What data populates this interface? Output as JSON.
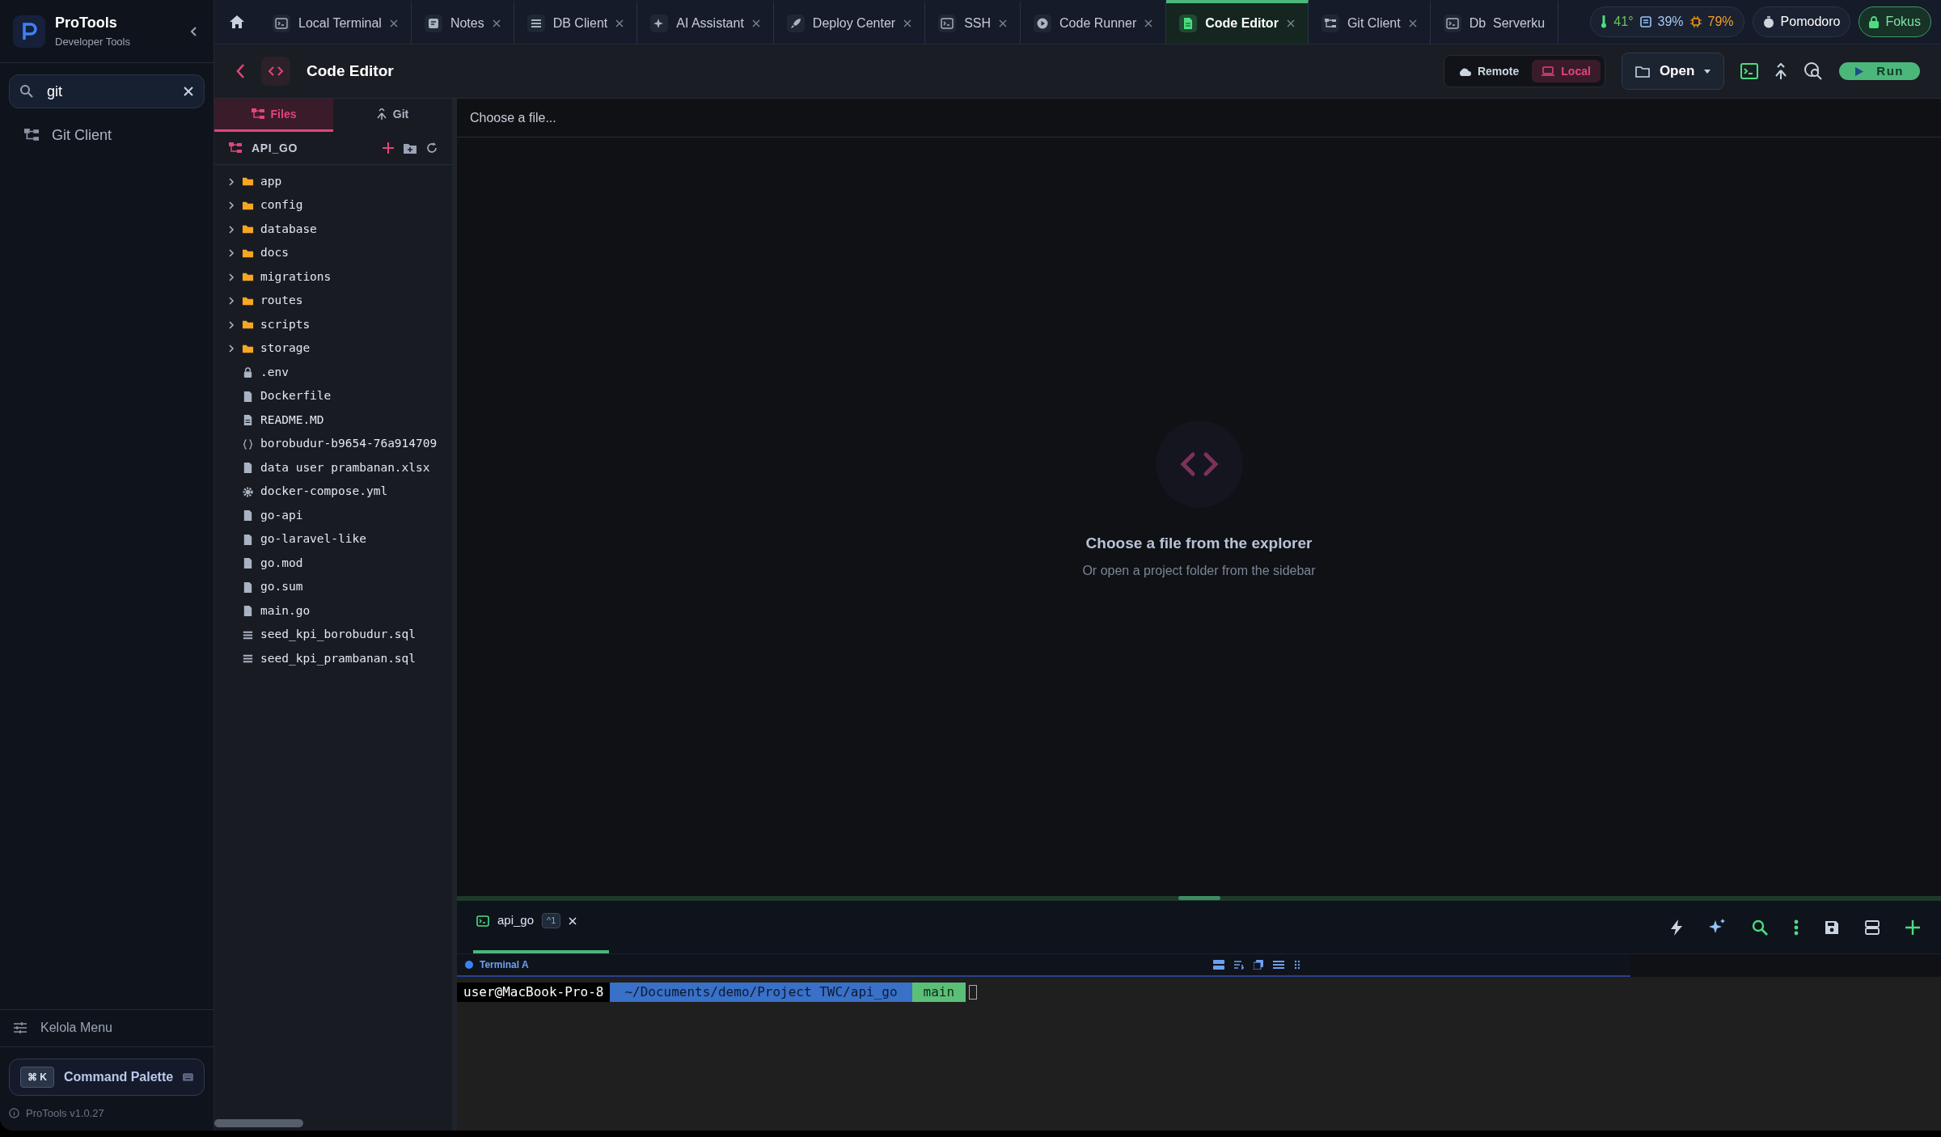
{
  "sidebar": {
    "app_name": "ProTools",
    "app_subtitle": "Developer Tools",
    "search": {
      "value": "git"
    },
    "items": [
      {
        "label": "Git Client",
        "selected": false
      }
    ],
    "manage_menu": "Kelola Menu",
    "command_palette": {
      "keys": "⌘ K",
      "label": "Command Palette"
    },
    "version": "ProTools v1.0.27"
  },
  "tabs": [
    {
      "label": "Local Terminal",
      "kind": "terminal",
      "selected": false
    },
    {
      "label": "Notes",
      "kind": "note",
      "selected": false
    },
    {
      "label": "DB Client",
      "kind": "list",
      "selected": false
    },
    {
      "label": "AI Assistant",
      "kind": "sparkle",
      "selected": false
    },
    {
      "label": "Deploy Center",
      "kind": "rocket",
      "selected": false
    },
    {
      "label": "SSH",
      "kind": "terminal",
      "selected": false
    },
    {
      "label": "Code Runner",
      "kind": "play",
      "selected": false
    },
    {
      "label": "Code Editor",
      "kind": "file",
      "selected": true
    },
    {
      "label": "Git Client",
      "kind": "tree",
      "selected": false
    },
    {
      "label": "Db  Serverku",
      "kind": "terminal",
      "selected": false
    }
  ],
  "status": {
    "temperature": "41°",
    "memory": "39%",
    "cpu": "79%"
  },
  "pomodoro": "Pomodoro",
  "focus": "Fokus",
  "header": {
    "title": "Code Editor",
    "modes": [
      {
        "label": "Remote",
        "selected": false
      },
      {
        "label": "Local",
        "selected": true
      }
    ],
    "open_button": "Open",
    "run_button": "Run"
  },
  "explorer": {
    "tabs": [
      {
        "label": "Files",
        "selected": true
      },
      {
        "label": "Git",
        "selected": false
      }
    ],
    "project": "API_GO",
    "tree": [
      {
        "name": "app",
        "kind": "folder",
        "expanded": false
      },
      {
        "name": "config",
        "kind": "folder",
        "expanded": false
      },
      {
        "name": "database",
        "kind": "folder",
        "expanded": false
      },
      {
        "name": "docs",
        "kind": "folder",
        "expanded": false
      },
      {
        "name": "migrations",
        "kind": "folder",
        "expanded": false
      },
      {
        "name": "routes",
        "kind": "folder",
        "expanded": false
      },
      {
        "name": "scripts",
        "kind": "folder",
        "expanded": false
      },
      {
        "name": "storage",
        "kind": "folder",
        "expanded": false
      },
      {
        "name": ".env",
        "kind": "lock"
      },
      {
        "name": "Dockerfile",
        "kind": "file"
      },
      {
        "name": "README.MD",
        "kind": "doc"
      },
      {
        "name": "borobudur-b9654-76a914709",
        "kind": "json"
      },
      {
        "name": "data user prambanan.xlsx",
        "kind": "file"
      },
      {
        "name": "docker-compose.yml",
        "kind": "settings"
      },
      {
        "name": "go-api",
        "kind": "file"
      },
      {
        "name": "go-laravel-like",
        "kind": "file"
      },
      {
        "name": "go.mod",
        "kind": "file"
      },
      {
        "name": "go.sum",
        "kind": "file"
      },
      {
        "name": "main.go",
        "kind": "file"
      },
      {
        "name": "seed_kpi_borobudur.sql",
        "kind": "db"
      },
      {
        "name": "seed_kpi_prambanan.sql",
        "kind": "db"
      }
    ]
  },
  "editor": {
    "path_placeholder": "Choose a file...",
    "empty_title": "Choose a file from the explorer",
    "empty_subtitle": "Or open a project folder from the sidebar"
  },
  "terminal": {
    "tabs": [
      {
        "label": "api_go",
        "shortcut": "^1",
        "selected": true
      }
    ],
    "session": "Terminal A",
    "prompt": {
      "user": "user@MacBook-Pro-8",
      "path": "~/Documents/demo/Project TWC/api_go",
      "branch": "main"
    }
  }
}
